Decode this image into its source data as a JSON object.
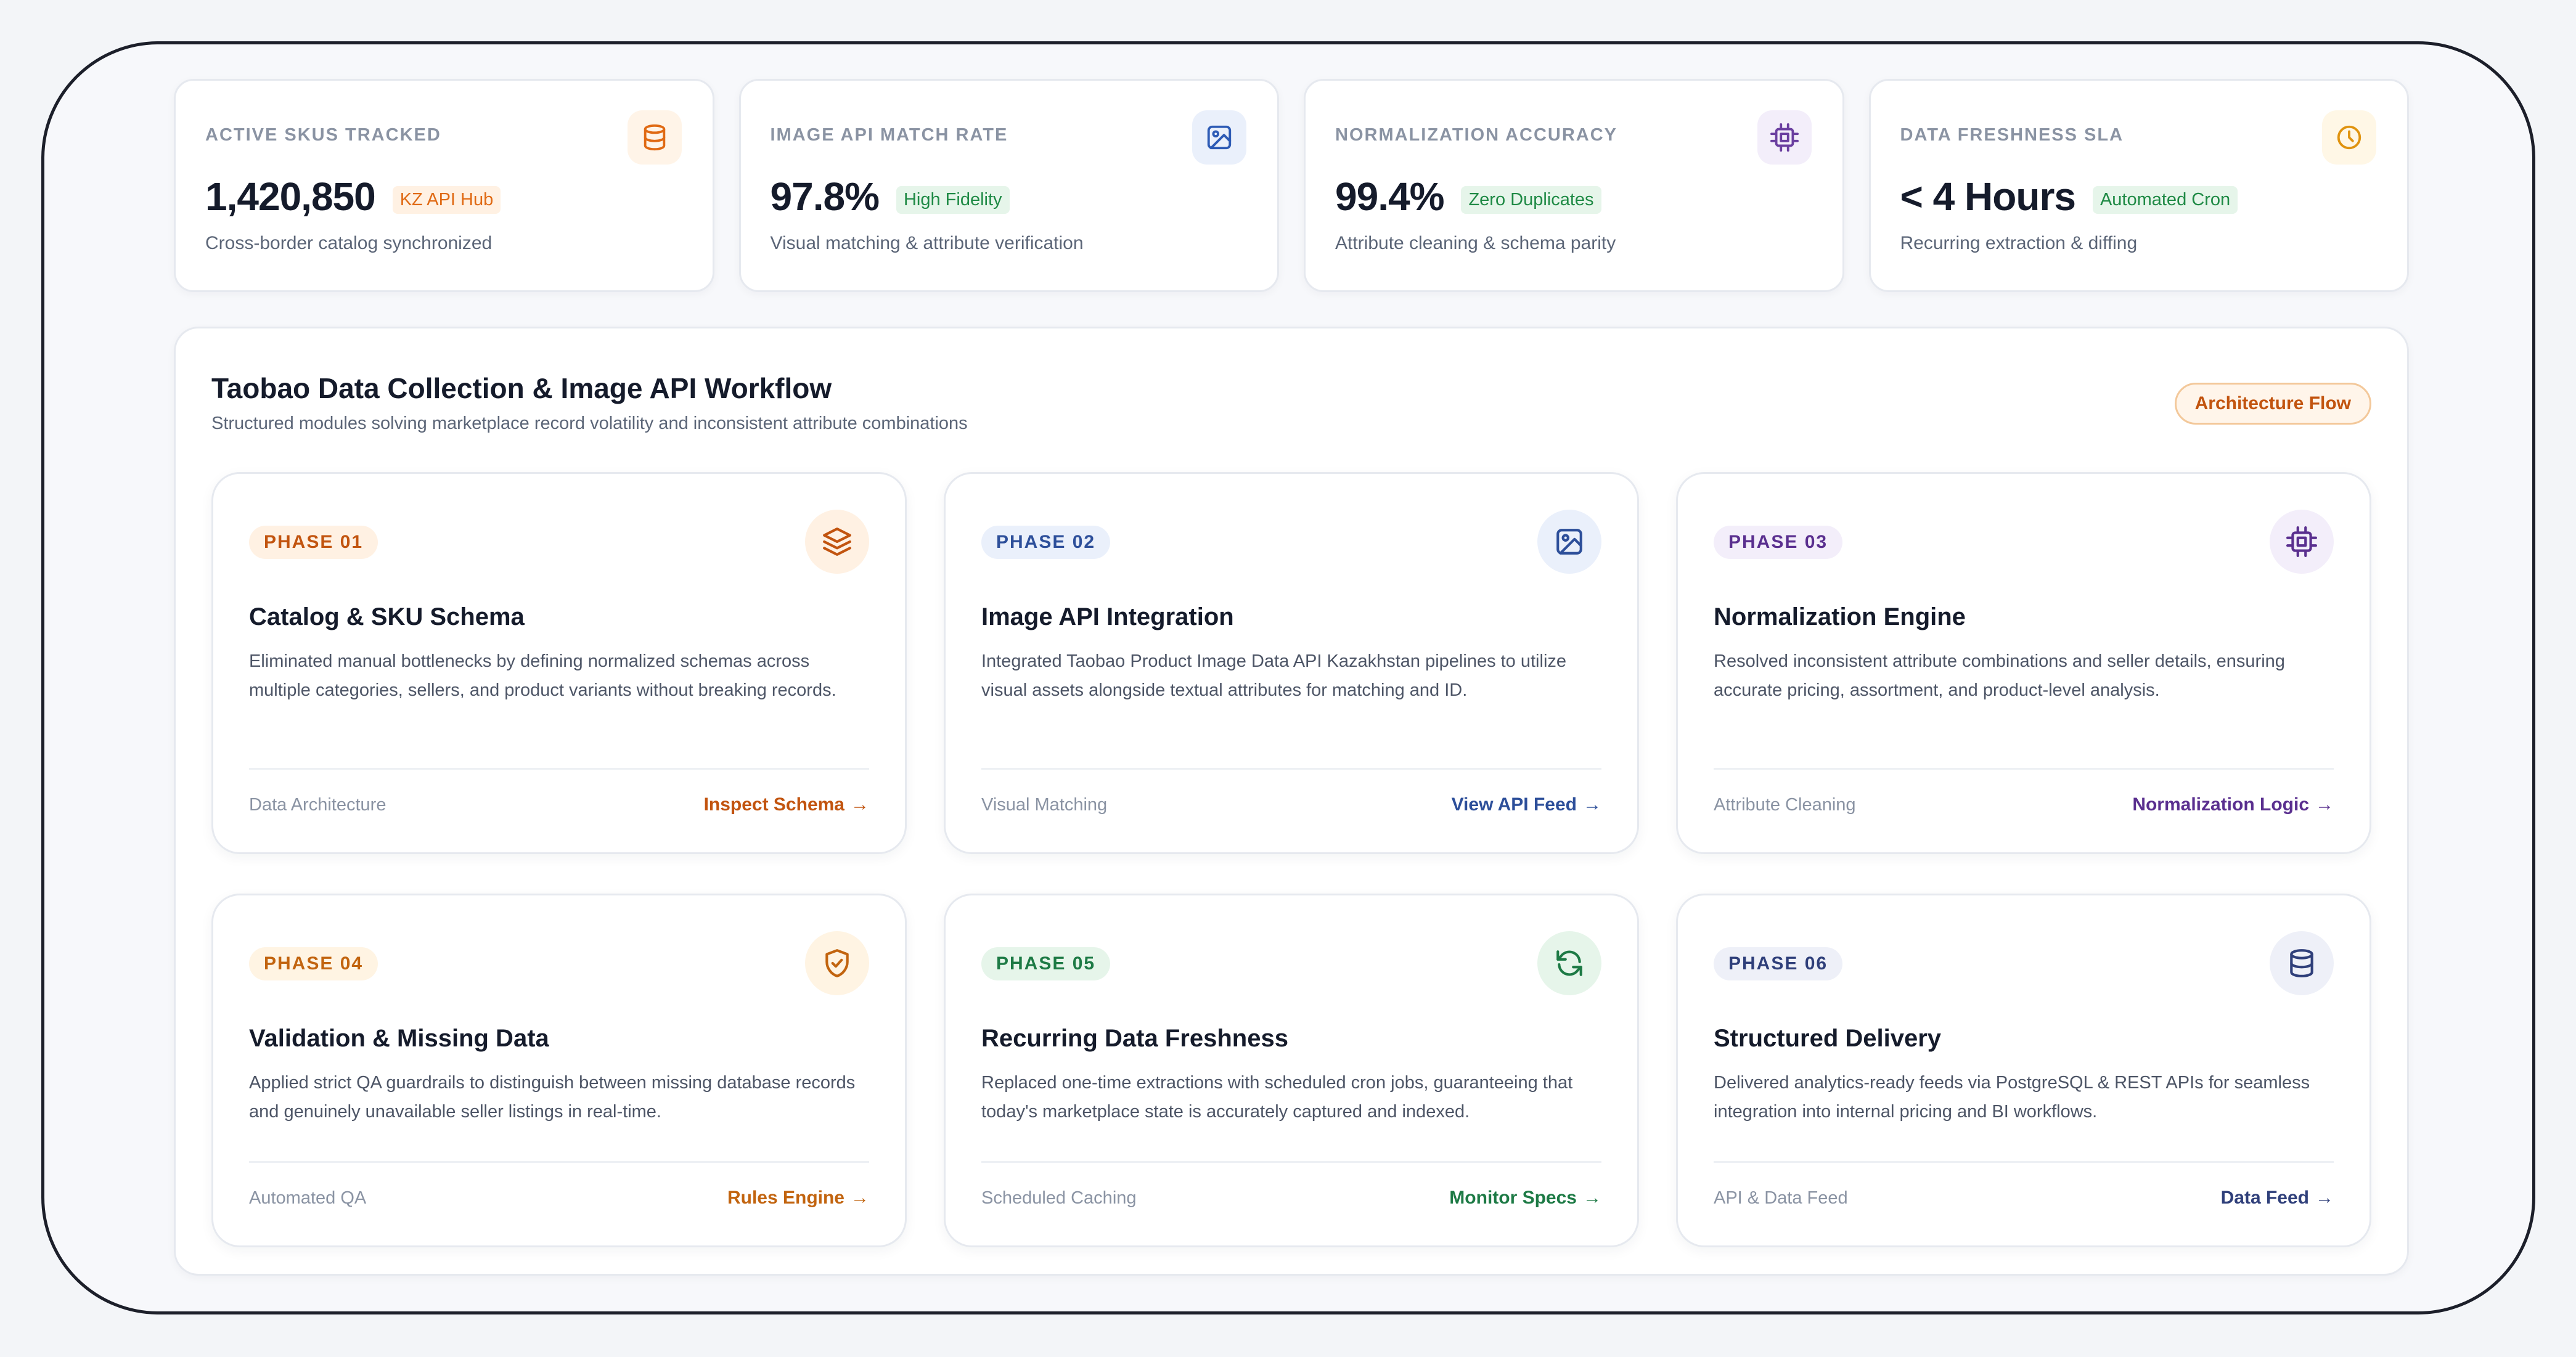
{
  "kpis": [
    {
      "label": "ACTIVE SKUS TRACKED",
      "value": "1,420,850",
      "badge": "KZ API Hub",
      "sub": "Cross-border catalog synchronized",
      "icon": "database-icon",
      "accent": "#e06a14",
      "badge_bg": "#fff1e3",
      "icon_bg": "#fff4e8"
    },
    {
      "label": "IMAGE API MATCH RATE",
      "value": "97.8%",
      "badge": "High Fidelity",
      "sub": "Visual matching & attribute verification",
      "icon": "image-icon",
      "accent": "#2d5bb5",
      "badge_bg": "#e6f5ea",
      "badge_color": "#1f8a45",
      "icon_bg": "#eaf0fb"
    },
    {
      "label": "NORMALIZATION ACCURACY",
      "value": "99.4%",
      "badge": "Zero Duplicates",
      "sub": "Attribute cleaning & schema parity",
      "icon": "cpu-icon",
      "accent": "#6b3fa0",
      "badge_bg": "#e6f5ea",
      "badge_color": "#1f8a45",
      "icon_bg": "#f3eefa"
    },
    {
      "label": "DATA FRESHNESS SLA",
      "value": "< 4 Hours",
      "badge": "Automated Cron",
      "sub": "Recurring extraction & diffing",
      "icon": "clock-icon",
      "accent": "#e0930f",
      "badge_bg": "#e6f5ea",
      "badge_color": "#1f8a45",
      "icon_bg": "#fff7e6"
    }
  ],
  "panel": {
    "title": "Taobao Data Collection & Image API Workflow",
    "subtitle": "Structured modules solving marketplace record volatility and inconsistent attribute combinations",
    "tag": "Architecture Flow"
  },
  "phases": [
    {
      "phase": "PHASE 01",
      "title": "Catalog & SKU Schema",
      "desc": "Eliminated manual bottlenecks by defining normalized schemas across multiple categories, sellers, and product variants without breaking records.",
      "foot_left": "Data Architecture",
      "foot_right": "Inspect Schema",
      "icon": "layers-icon",
      "color": "#c2540f",
      "bg": "#fff1e3"
    },
    {
      "phase": "PHASE 02",
      "title": "Image API Integration",
      "desc": "Integrated Taobao Product Image Data API Kazakhstan pipelines to utilize visual assets alongside textual attributes for matching and ID.",
      "foot_left": "Visual Matching",
      "foot_right": "View API Feed",
      "icon": "image-icon",
      "color": "#2d4f9a",
      "bg": "#eaf0fb"
    },
    {
      "phase": "PHASE 03",
      "title": "Normalization Engine",
      "desc": "Resolved inconsistent attribute combinations and seller details, ensuring accurate pricing, assortment, and product-level analysis.",
      "foot_left": "Attribute Cleaning",
      "foot_right": "Normalization Logic",
      "icon": "cpu-icon",
      "color": "#5a2f8f",
      "bg": "#f3eefa"
    },
    {
      "phase": "PHASE 04",
      "title": "Validation & Missing Data",
      "desc": "Applied strict QA guardrails to distinguish between missing database records and genuinely unavailable seller listings in real-time.",
      "foot_left": "Automated QA",
      "foot_right": "Rules Engine",
      "icon": "shield-check-icon",
      "color": "#c2640f",
      "bg": "#fff4e3"
    },
    {
      "phase": "PHASE 05",
      "title": "Recurring Data Freshness",
      "desc": "Replaced one-time extractions with scheduled cron jobs, guaranteeing that today's marketplace state is accurately captured and indexed.",
      "foot_left": "Scheduled Caching",
      "foot_right": "Monitor Specs",
      "icon": "refresh-icon",
      "color": "#1d7a45",
      "bg": "#e6f5ea"
    },
    {
      "phase": "PHASE 06",
      "title": "Structured Delivery",
      "desc": "Delivered analytics-ready feeds via PostgreSQL & REST APIs for seamless integration into internal pricing and BI workflows.",
      "foot_left": "API & Data Feed",
      "foot_right": "Data Feed",
      "icon": "database-icon",
      "color": "#2f3f7a",
      "bg": "#eef0f8"
    }
  ]
}
